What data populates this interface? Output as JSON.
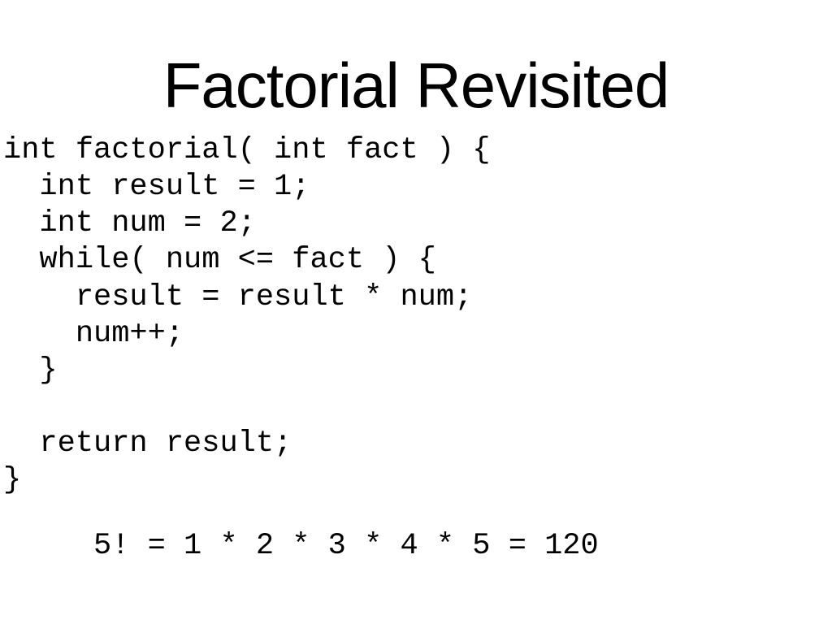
{
  "slide": {
    "title": "Factorial Revisited",
    "code": "int factorial( int fact ) {\n  int result = 1;\n  int num = 2;\n  while( num <= fact ) {\n    result = result * num;\n    num++;\n  }\n\n  return result;\n}",
    "example": "     5! = 1 * 2 * 3 * 4 * 5 = 120"
  }
}
